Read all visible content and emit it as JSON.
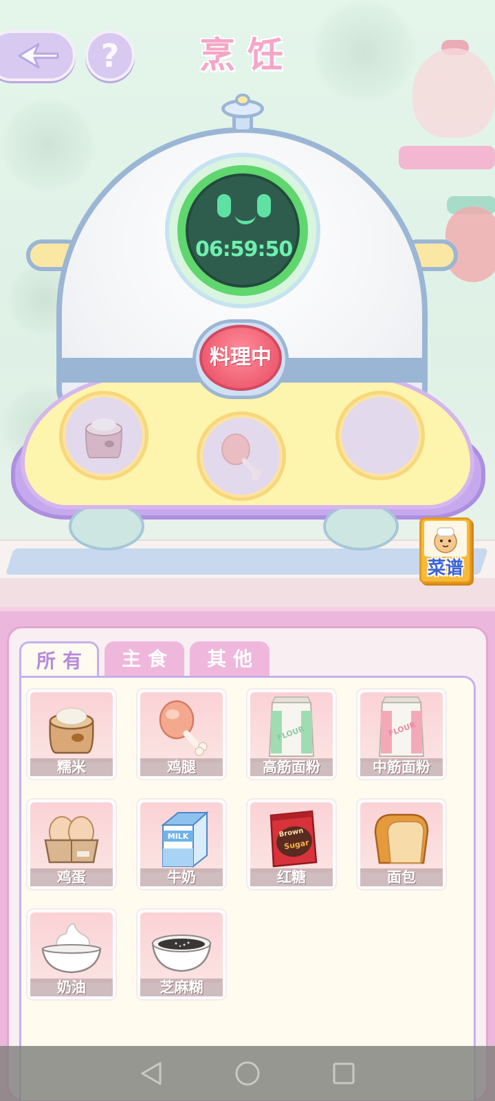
{
  "header": {
    "title": "烹饪",
    "back_icon": "back-arrow-icon",
    "help_label": "?"
  },
  "machine": {
    "timer": "06:59:50",
    "status_button": "料理中",
    "slots": [
      {
        "icon": "rice-sack-icon",
        "filled": true
      },
      {
        "icon": "chicken-leg-icon",
        "filled": true
      },
      {
        "icon": "empty-slot",
        "filled": false
      }
    ]
  },
  "recipe_book": {
    "label": "菜谱"
  },
  "inventory": {
    "tabs": [
      {
        "label": "所有",
        "active": true
      },
      {
        "label": "主食",
        "active": false
      },
      {
        "label": "其他",
        "active": false
      }
    ],
    "items": [
      {
        "label": "糯米",
        "icon": "rice-sack-icon"
      },
      {
        "label": "鸡腿",
        "icon": "chicken-leg-icon"
      },
      {
        "label": "高筋面粉",
        "icon": "flour-green-bag-icon"
      },
      {
        "label": "中筋面粉",
        "icon": "flour-pink-bag-icon"
      },
      {
        "label": "鸡蛋",
        "icon": "egg-carton-icon"
      },
      {
        "label": "牛奶",
        "icon": "milk-carton-icon"
      },
      {
        "label": "红糖",
        "icon": "brown-sugar-bag-icon"
      },
      {
        "label": "面包",
        "icon": "bread-loaf-icon"
      },
      {
        "label": "奶油",
        "icon": "cream-bowl-icon"
      },
      {
        "label": "芝麻糊",
        "icon": "sesame-paste-bowl-icon"
      }
    ]
  },
  "navbar": {
    "back": "nav-back-icon",
    "home": "nav-home-icon",
    "recents": "nav-recents-icon"
  },
  "colors": {
    "title_pink": "#f5a6c7",
    "button_red": "#ef5d72",
    "screen_green": "#5fd66e",
    "panel_pink": "#ecb7dc",
    "tab_purple": "#b58ad9"
  }
}
